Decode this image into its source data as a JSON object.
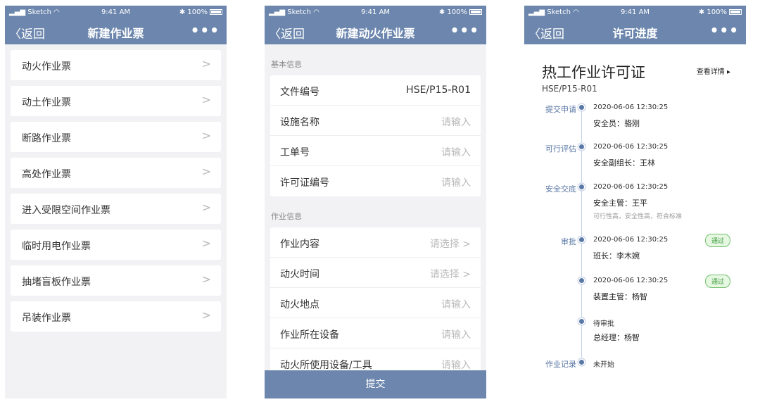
{
  "status": {
    "carrier": "Sketch",
    "time": "9:41 AM",
    "battery": "100%"
  },
  "nav": {
    "back_label": "返回",
    "more_label": "•••"
  },
  "screen1": {
    "title": "新建作业票",
    "items": [
      {
        "label": "动火作业票"
      },
      {
        "label": "动土作业票"
      },
      {
        "label": "断路作业票"
      },
      {
        "label": "高处作业票"
      },
      {
        "label": "进入受限空间作业票"
      },
      {
        "label": "临时用电作业票"
      },
      {
        "label": "抽堵盲板作业票"
      },
      {
        "label": "吊装作业票"
      }
    ]
  },
  "screen2": {
    "title": "新建动火作业票",
    "section_basic": "基本信息",
    "basic_rows": [
      {
        "label": "文件编号",
        "value": "HSE/P15-R01"
      },
      {
        "label": "设施名称",
        "value": "请输入"
      },
      {
        "label": "工单号",
        "value": "请输入"
      },
      {
        "label": "许可证编号",
        "value": "请输入"
      }
    ],
    "section_work": "作业信息",
    "work_rows": [
      {
        "label": "作业内容",
        "value": "请选择 >"
      },
      {
        "label": "动火时间",
        "value": "请选择 >"
      },
      {
        "label": "动火地点",
        "value": "请输入"
      },
      {
        "label": "作业所在设备",
        "value": "请输入"
      },
      {
        "label": "动火所使用设备/工具",
        "value": "请输入"
      }
    ],
    "submit_label": "提交"
  },
  "screen3": {
    "title": "许可进度",
    "permit_title": "热工作业许可证",
    "detail_link": "查看详情 ▸",
    "permit_code": "HSE/P15-R01",
    "steps": [
      {
        "label": "提交申请",
        "time": "2020-06-06 12:30:25",
        "person": "安全员：骆刚"
      },
      {
        "label": "可行评估",
        "time": "2020-06-06 12:30:25",
        "person": "安全副组长：王林"
      },
      {
        "label": "安全交底",
        "time": "2020-06-06 12:30:25",
        "person": "安全主管：王平",
        "note": "可行性高，安全性高，符合标准"
      },
      {
        "label": "审批",
        "time": "2020-06-06 12:30:25",
        "person": "班长：李木婉",
        "badge": "通过"
      },
      {
        "label": "",
        "time": "2020-06-06 12:30:25",
        "person": "装置主管：杨智",
        "badge": "通过"
      },
      {
        "label": "",
        "time": "待审批",
        "person": "总经理：杨智"
      },
      {
        "label": "作业记录",
        "time": "未开始"
      }
    ]
  }
}
